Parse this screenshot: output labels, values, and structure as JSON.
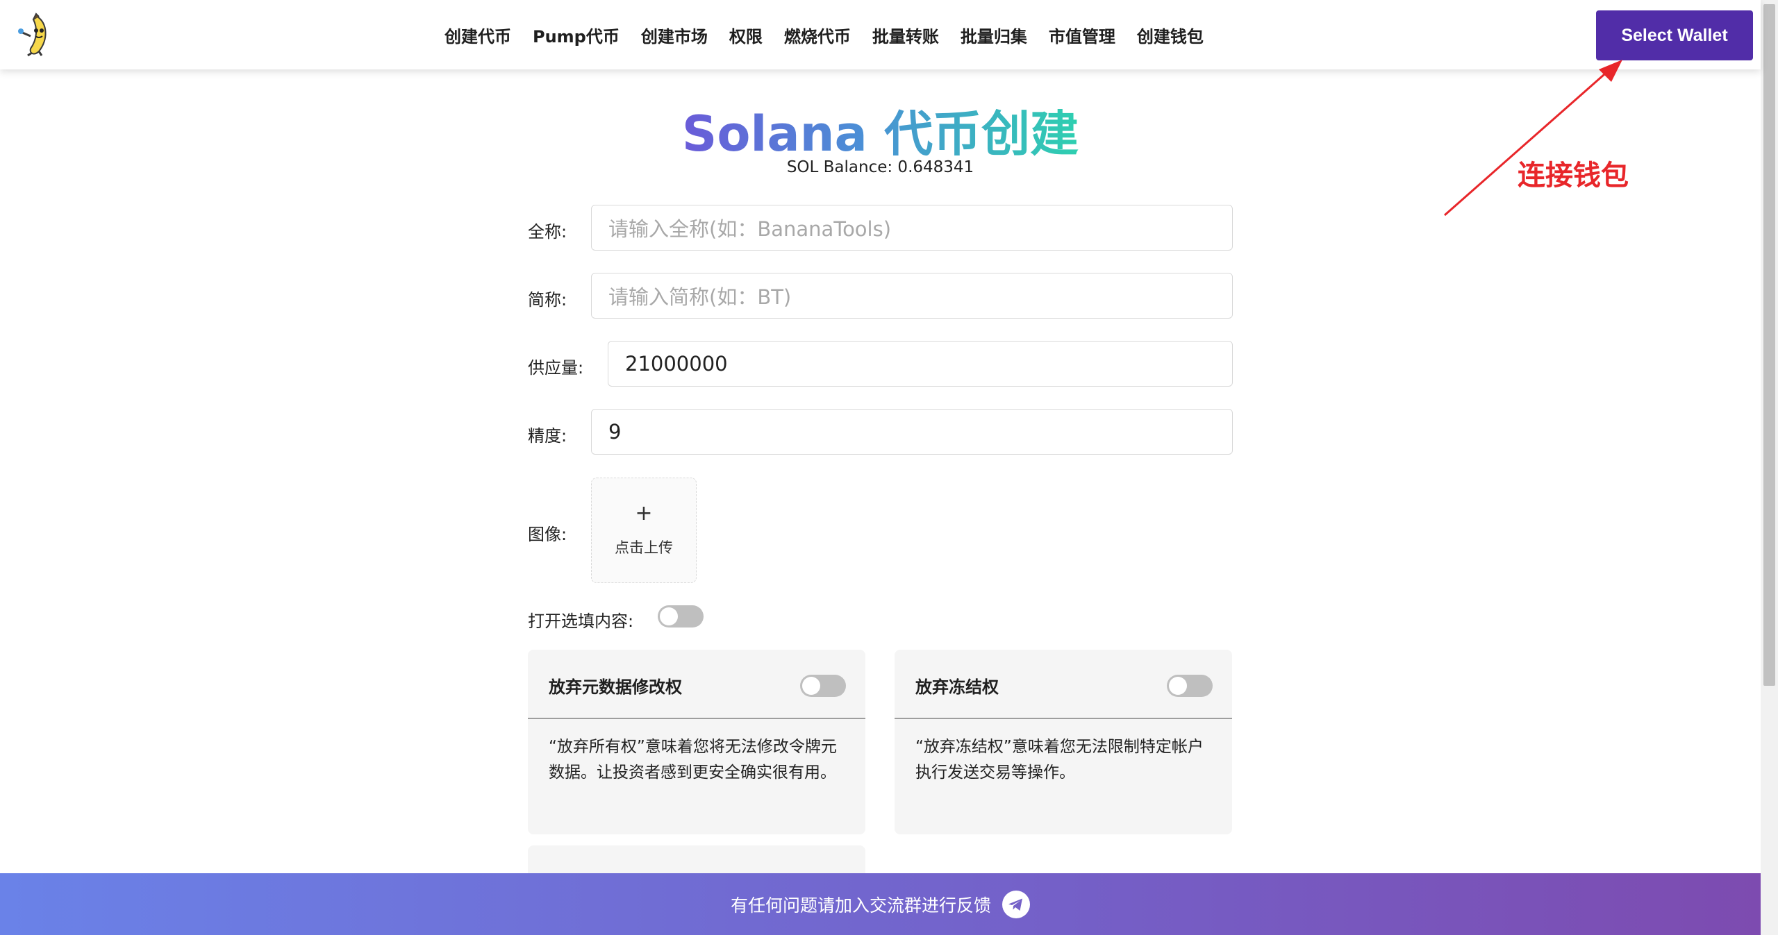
{
  "nav": {
    "items": [
      "创建代币",
      "Pump代币",
      "创建市场",
      "权限",
      "燃烧代币",
      "批量转账",
      "批量归集",
      "市值管理",
      "创建钱包"
    ]
  },
  "wallet_button": "Select Wallet",
  "annotation": "连接钱包",
  "title": "Solana 代币创建",
  "balance": "SOL Balance: 0.648341",
  "form": {
    "name": {
      "label": "全称:",
      "placeholder": "请输入全称(如：BananaTools)"
    },
    "symbol": {
      "label": "简称:",
      "placeholder": "请输入简称(如：BT)"
    },
    "supply": {
      "label": "供应量:",
      "value": "21000000"
    },
    "decimals": {
      "label": "精度:",
      "value": "9"
    },
    "image": {
      "label": "图像:",
      "upload_icon": "+",
      "upload_text": "点击上传"
    },
    "optional": {
      "label": "打开选填内容:",
      "enabled": false
    }
  },
  "cards": [
    {
      "title": "放弃元数据修改权",
      "description": "“放弃所有权”意味着您将无法修改令牌元数据。让投资者感到更安全确实很有用。",
      "enabled": false
    },
    {
      "title": "放弃冻结权",
      "description": "“放弃冻结权”意味着您无法限制特定帐户执行发送交易等操作。",
      "enabled": false
    }
  ],
  "footer": {
    "text": "有任何问题请加入交流群进行反馈"
  },
  "colors": {
    "accent": "#512da8",
    "annotation": "#e8262a",
    "title_gradient_start": "#6a5bd8",
    "title_gradient_end": "#2ecfb0"
  },
  "icons": {
    "logo": "banana-logo-icon",
    "footer": "telegram-icon"
  }
}
